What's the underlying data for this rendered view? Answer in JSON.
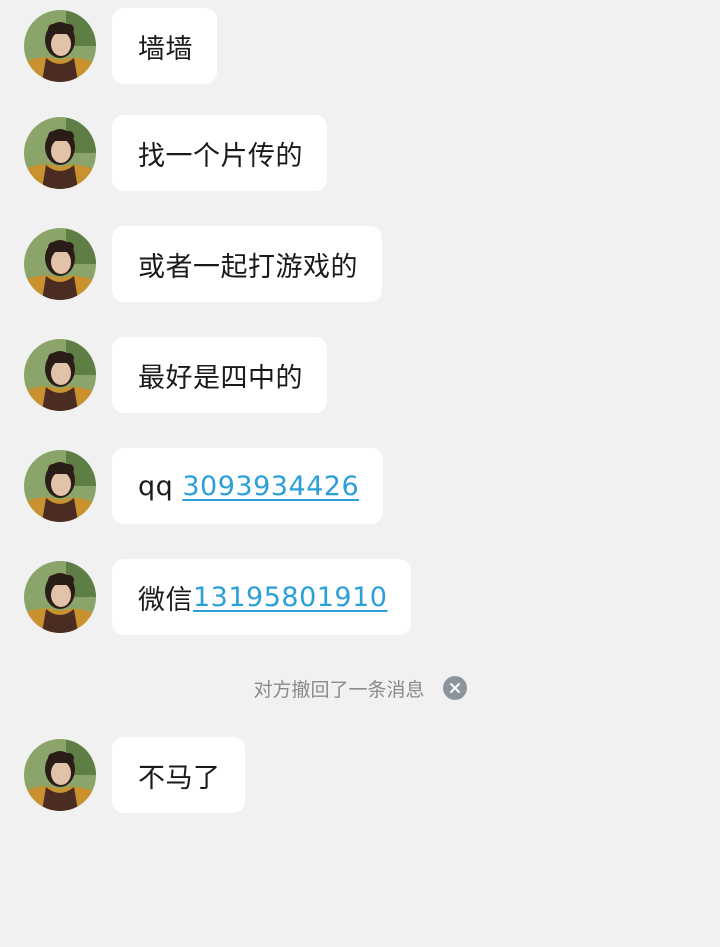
{
  "messages": [
    {
      "text": "墙墙",
      "link": ""
    },
    {
      "text": "找一个片传的",
      "link": ""
    },
    {
      "text": "或者一起打游戏的",
      "link": ""
    },
    {
      "text": "最好是四中的",
      "link": ""
    },
    {
      "text": "qq ",
      "link": "3093934426"
    },
    {
      "text": "微信",
      "link": "13195801910"
    },
    {
      "text": "不马了",
      "link": ""
    }
  ],
  "system_notice": {
    "text": "对方撤回了一条消息",
    "icon": "close-circle-icon"
  },
  "colors": {
    "background": "#f1f1f1",
    "bubble": "#ffffff",
    "link": "#2b9fd8",
    "notice_text": "#8a8a8a"
  }
}
